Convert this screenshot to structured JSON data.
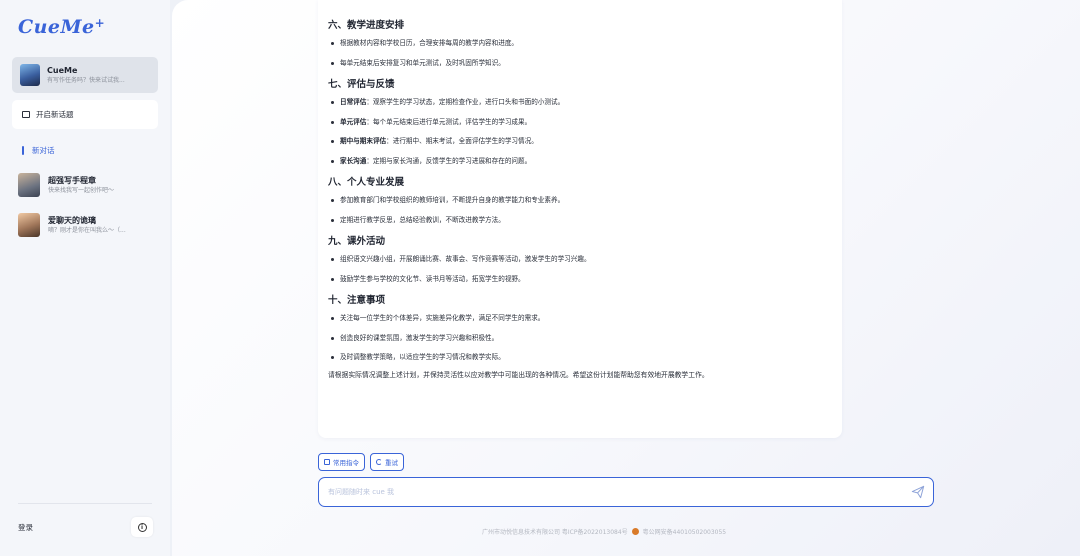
{
  "sidebar": {
    "logo": "CueMe",
    "logo_plus": "+",
    "assistant": {
      "name": "CueMe",
      "subtitle": "有写作任务吗？快来试试我..."
    },
    "new_topic_label": "开启新话题",
    "new_chat_label": "新对话",
    "chats": [
      {
        "name": "超强写手程章",
        "subtitle": "快来找我写一起创作吧～"
      },
      {
        "name": "爱聊天的诡璃",
        "subtitle": "嘀？刚才是你在叫我么～（..."
      }
    ],
    "login_label": "登录",
    "info_glyph": "i"
  },
  "content": {
    "sections": [
      {
        "title": "六、教学进度安排",
        "items": [
          {
            "bold": "",
            "text": "根据教材内容和学校日历，合理安排每周的教学内容和进度。"
          },
          {
            "bold": "",
            "text": "每单元结束后安排复习和单元测试，及时巩固所学知识。"
          }
        ]
      },
      {
        "title": "七、评估与反馈",
        "items": [
          {
            "bold": "日常评估",
            "text": "：观察学生的学习状态，定期检查作业，进行口头和书面的小测试。"
          },
          {
            "bold": "单元评估",
            "text": "：每个单元结束后进行单元测试，评估学生的学习成果。"
          },
          {
            "bold": "期中与期末评估",
            "text": "：进行期中、期末考试，全面评估学生的学习情况。"
          },
          {
            "bold": "家长沟通",
            "text": "：定期与家长沟通，反馈学生的学习进展和存在的问题。"
          }
        ]
      },
      {
        "title": "八、个人专业发展",
        "items": [
          {
            "bold": "",
            "text": "参加教育部门和学校组织的教师培训，不断提升自身的教学能力和专业素养。"
          },
          {
            "bold": "",
            "text": "定期进行教学反思，总结经验教训，不断改进教学方法。"
          }
        ]
      },
      {
        "title": "九、课外活动",
        "items": [
          {
            "bold": "",
            "text": "组织语文兴趣小组，开展朗诵比赛、故事会、写作竞赛等活动，激发学生的学习兴趣。"
          },
          {
            "bold": "",
            "text": "鼓励学生参与学校的文化节、读书月等活动，拓宽学生的视野。"
          }
        ]
      },
      {
        "title": "十、注意事项",
        "items": [
          {
            "bold": "",
            "text": "关注每一位学生的个体差异，实施差异化教学，满足不同学生的需求。"
          },
          {
            "bold": "",
            "text": "创造良好的课堂氛围，激发学生的学习兴趣和积极性。"
          },
          {
            "bold": "",
            "text": "及时调整教学策略，以适应学生的学习情况和教学实际。"
          }
        ]
      }
    ],
    "closing": "请根据实际情况调整上述计划，并保持灵活性以应对教学中可能出现的各种情况。希望这份计划能帮助您有效地开展教学工作。"
  },
  "actions": {
    "common_commands_label": "常用指令",
    "retry_label": "重试"
  },
  "input": {
    "placeholder": "有问题随时来 cue 我",
    "value": ""
  },
  "footer": {
    "company": "广州市动悦信息技术有限公司 粤ICP备2022013084号",
    "police": "粤公网安备44010502003055"
  },
  "colors": {
    "accent": "#3a64d8",
    "sidebar_bg": "#f4f6fa",
    "active_card_bg": "#dfe3ea"
  }
}
